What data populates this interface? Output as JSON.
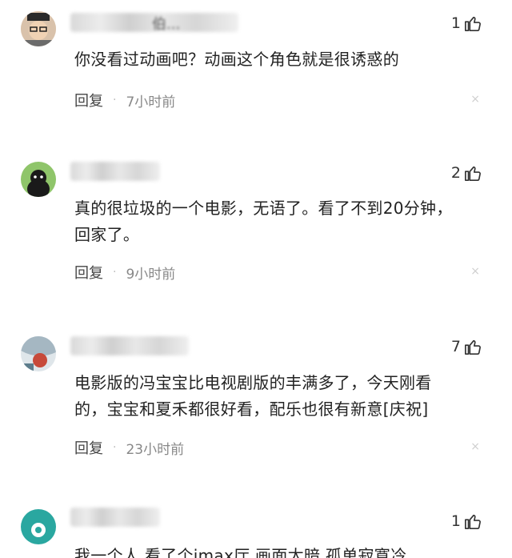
{
  "comments": [
    {
      "username_fragment": "伯...",
      "likes": "1",
      "content_lines": [
        "你没看过动画吧？动画这个角色就是很诱惑的"
      ],
      "reply_label": "回复",
      "separator": "·",
      "time": "7小时前",
      "close_glyph": "×"
    },
    {
      "likes": "2",
      "content_lines": [
        "真的很垃圾的一个电影，无语了。看了不到20分钟，",
        "回家了。"
      ],
      "reply_label": "回复",
      "separator": "·",
      "time": "9小时前",
      "close_glyph": "×"
    },
    {
      "likes": "7",
      "content_lines": [
        "电影版的冯宝宝比电视剧版的丰满多了，今天刚看",
        "的，宝宝和夏禾都很好看，配乐也很有新意[庆祝]"
      ],
      "reply_label": "回复",
      "separator": "·",
      "time": "23小时前",
      "close_glyph": "×"
    },
    {
      "likes": "1",
      "content_lines": [
        "我一个人 看了个imax厅 画面太暗 孤单寂寞冷"
      ]
    }
  ],
  "icons": {
    "like": "thumbs-up-icon",
    "close": "close-icon"
  }
}
